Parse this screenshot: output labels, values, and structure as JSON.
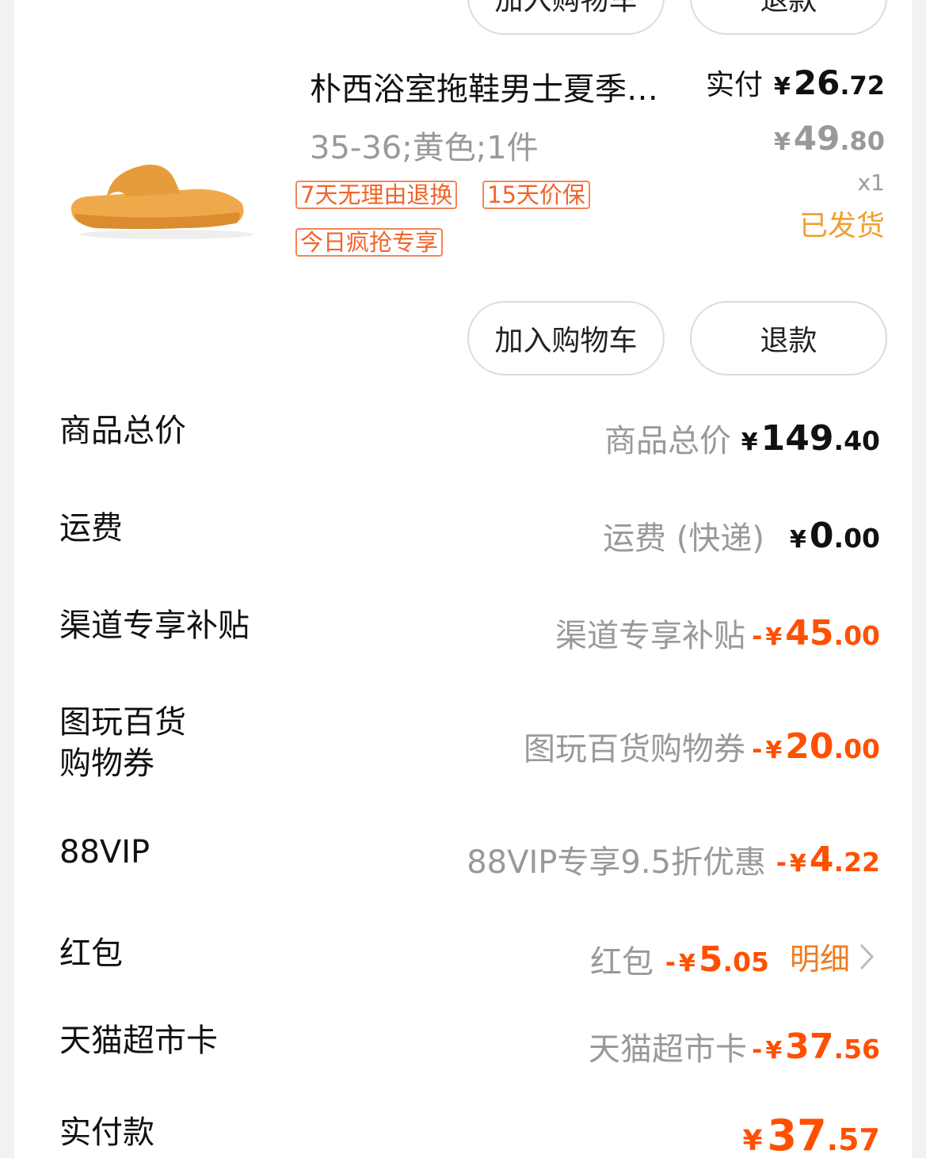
{
  "top_partial": {
    "add_cart_label": "加入购物车",
    "refund_label": "退款"
  },
  "item": {
    "title": "朴西浴室拖鞋男士夏季…",
    "paid_label": "实付",
    "paid_yen": "¥",
    "paid_int": "26",
    "paid_dec": ".72",
    "sku": "35-36;黄色;1件",
    "orig_yen": "¥",
    "orig_int": "49",
    "orig_dec": ".80",
    "qty": "x1",
    "status": "已发货",
    "tags": [
      "7天无理由退换",
      "15天价保",
      "今日疯抢专享"
    ],
    "add_cart_label": "加入购物车",
    "refund_label": "退款",
    "image_color": "#f0a94a"
  },
  "summary": [
    {
      "label": "商品总价",
      "desc": "商品总价",
      "sign": "",
      "yen": "¥",
      "int": "149",
      "dec": ".40"
    },
    {
      "label": "运费",
      "desc": "运费 (快递)",
      "sign": "",
      "yen": "¥",
      "int": "0",
      "dec": ".00"
    },
    {
      "label": "渠道专享补贴",
      "desc": "渠道专享补贴",
      "sign": "-",
      "yen": "¥",
      "int": "45",
      "dec": ".00"
    },
    {
      "label_line1": "图玩百货",
      "label_line2": "购物券",
      "desc": "图玩百货购物券",
      "sign": "-",
      "yen": "¥",
      "int": "20",
      "dec": ".00"
    },
    {
      "label": "88VIP",
      "desc": "88VIP专享9.5折优惠",
      "sign": "-",
      "yen": "¥",
      "int": "4",
      "dec": ".22"
    },
    {
      "label": "红包",
      "desc": "红包",
      "sign": "-",
      "yen": "¥",
      "int": "5",
      "dec": ".05",
      "detail": "明细"
    },
    {
      "label": "天猫超市卡",
      "desc": "天猫超市卡",
      "sign": "-",
      "yen": "¥",
      "int": "37",
      "dec": ".56"
    },
    {
      "label": "实付款",
      "yen": "¥",
      "int": "37",
      "dec": ".57"
    }
  ],
  "colors": {
    "accent": "#ff5000",
    "status": "#f0a030",
    "tag": "#f0642a"
  }
}
